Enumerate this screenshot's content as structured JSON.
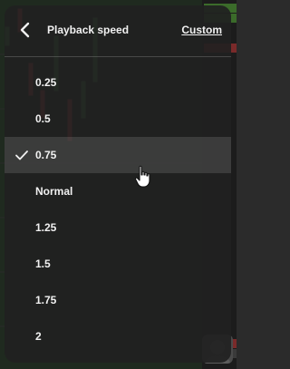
{
  "header": {
    "back_icon": "chevron-left-icon",
    "title": "Playback speed",
    "custom_label": "Custom"
  },
  "options": [
    {
      "label": "0.25",
      "selected": false
    },
    {
      "label": "0.5",
      "selected": false
    },
    {
      "label": "0.75",
      "selected": true
    },
    {
      "label": "Normal",
      "selected": false
    },
    {
      "label": "1.25",
      "selected": false
    },
    {
      "label": "1.5",
      "selected": false
    },
    {
      "label": "1.75",
      "selected": false
    },
    {
      "label": "2",
      "selected": false
    }
  ],
  "selected_icon": "check-icon",
  "pointer_icon": "hand-pointer-icon",
  "colors": {
    "panel": "#212121",
    "text": "#f1f1f1",
    "highlight": "#3b3b3b",
    "candle_up": "#3e8e3e",
    "candle_down": "#c94141"
  }
}
